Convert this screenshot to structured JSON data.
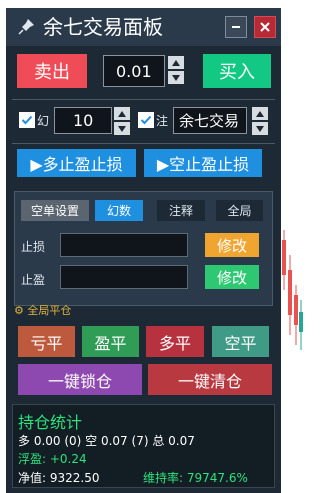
{
  "window": {
    "title": "余七交易面板",
    "icons": {
      "app": "pin-icon",
      "minimize": "minimize-icon",
      "close": "close-icon"
    }
  },
  "trade": {
    "sell_label": "卖出",
    "buy_label": "买入",
    "lot_value": "0.01"
  },
  "options": {
    "magic_label": "幻",
    "magic_checked": true,
    "magic_value": "10",
    "comment_label": "注",
    "comment_checked": true,
    "comment_value": "余七交易"
  },
  "sltp_buttons": {
    "long_label": "▶多止盈止损",
    "short_label": "▶空止盈止损"
  },
  "subpanel": {
    "tabs": [
      "空单设置",
      "幻数",
      "注释",
      "全局"
    ],
    "stop_loss_label": "止损",
    "stop_loss_value": "",
    "take_profit_label": "止盈",
    "take_profit_value": "",
    "modify_label": "修改"
  },
  "global_tag": "全局平仓",
  "close_buttons": {
    "loss": "亏平",
    "profit": "盈平",
    "long": "多平",
    "short": "空平"
  },
  "actions": {
    "lock": "一键锁仓",
    "clear": "一键清仓"
  },
  "stats": {
    "title": "持仓统计",
    "positions_line": "多 0.00 (0) 空 0.07 (7) 总 0.07",
    "float_label": "浮盈: +0.24",
    "equity_label": "净值: 9322.50",
    "margin_label": "维持率: 79747.6%"
  },
  "colors": {
    "sell": "#ef4c58",
    "buy": "#13c883",
    "blue": "#1f8fe0",
    "stats_green": "#2ee27c"
  }
}
